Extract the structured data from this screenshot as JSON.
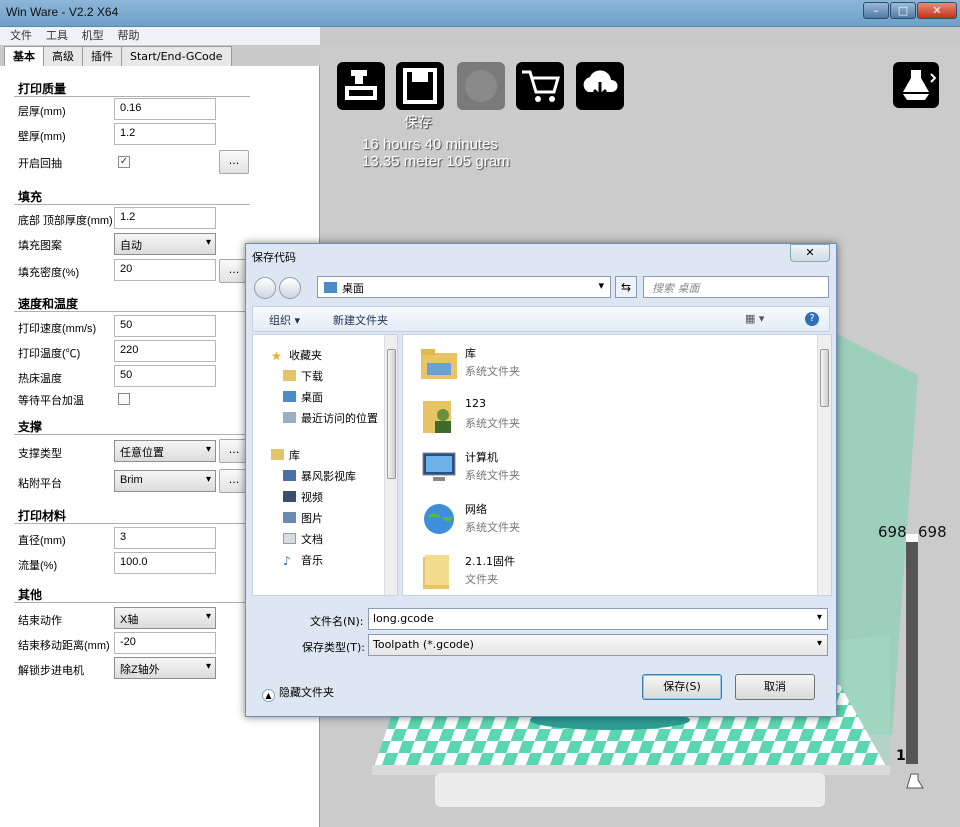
{
  "window": {
    "title": "Win Ware - V2.2 X64",
    "minimize": "–",
    "maximize": "□",
    "close": "✕"
  },
  "menu": [
    "文件",
    "工具",
    "机型",
    "帮助"
  ],
  "tabs": [
    "基本",
    "高级",
    "插件",
    "Start/End-GCode"
  ],
  "settings": {
    "quality": {
      "title": "打印质量",
      "layer_label": "层厚(mm)",
      "layer_value": "0.16",
      "wall_label": "壁厚(mm)",
      "wall_value": "1.2",
      "retract_label": "开启回抽",
      "retract_checked": "✓"
    },
    "fill": {
      "title": "填充",
      "bt_label": "底部 顶部厚度(mm)",
      "bt_value": "1.2",
      "pattern_label": "填充图案",
      "pattern_value": "自动",
      "density_label": "填充密度(%)",
      "density_value": "20"
    },
    "speed": {
      "title": "速度和温度",
      "speed_label": "打印速度(mm/s)",
      "speed_value": "50",
      "temp_label": "打印温度(℃)",
      "temp_value": "220",
      "bed_label": "热床温度",
      "bed_value": "50",
      "wait_label": "等待平台加温"
    },
    "support": {
      "title": "支撑",
      "type_label": "支撑类型",
      "type_value": "任意位置",
      "adhesion_label": "粘附平台",
      "adhesion_value": "Brim"
    },
    "material": {
      "title": "打印材料",
      "diameter_label": "直径(mm)",
      "diameter_value": "3",
      "flow_label": "流量(%)",
      "flow_value": "100.0"
    },
    "other": {
      "title": "其他",
      "end_label": "结束动作",
      "end_value": "X轴",
      "move_label": "结束移动距离(mm)",
      "move_value": "-20",
      "unlock_label": "解锁步进电机",
      "unlock_value": "除Z轴外"
    },
    "dots": "..."
  },
  "viewer": {
    "save_label": "保存",
    "time": "16 hours 40 minutes",
    "material": "13.35 meter 105 gram",
    "layer_top_left": "698",
    "layer_top_right": "698",
    "layer_bottom": "1"
  },
  "dialog": {
    "title": "保存代码",
    "close": "✕",
    "address": "桌面",
    "search_placeholder": "搜索 桌面",
    "organize": "组织 ▾",
    "new_folder": "新建文件夹",
    "nav_items": [
      "收藏夹",
      "下载",
      "桌面",
      "最近访问的位置",
      "库",
      "暴风影视库",
      "视频",
      "图片",
      "文档",
      "音乐"
    ],
    "files": [
      {
        "name": "库",
        "type": "系统文件夹"
      },
      {
        "name": "123",
        "type": "系统文件夹"
      },
      {
        "name": "计算机",
        "type": "系统文件夹"
      },
      {
        "name": "网络",
        "type": "系统文件夹"
      },
      {
        "name": "2.1.1固件",
        "type": "文件夹"
      }
    ],
    "filename_label": "文件名(N):",
    "filename_value": "long.gcode",
    "filetype_label": "保存类型(T):",
    "filetype_value": "Toolpath (*.gcode)",
    "hide_folders": "隐藏文件夹",
    "save_button": "保存(S)",
    "cancel_button": "取消"
  },
  "colors": {
    "accent": "#5ad7b0",
    "checker_a": "#5ad7b0",
    "checker_b": "#ffffff",
    "dialog_bg": "#dce7f3"
  }
}
